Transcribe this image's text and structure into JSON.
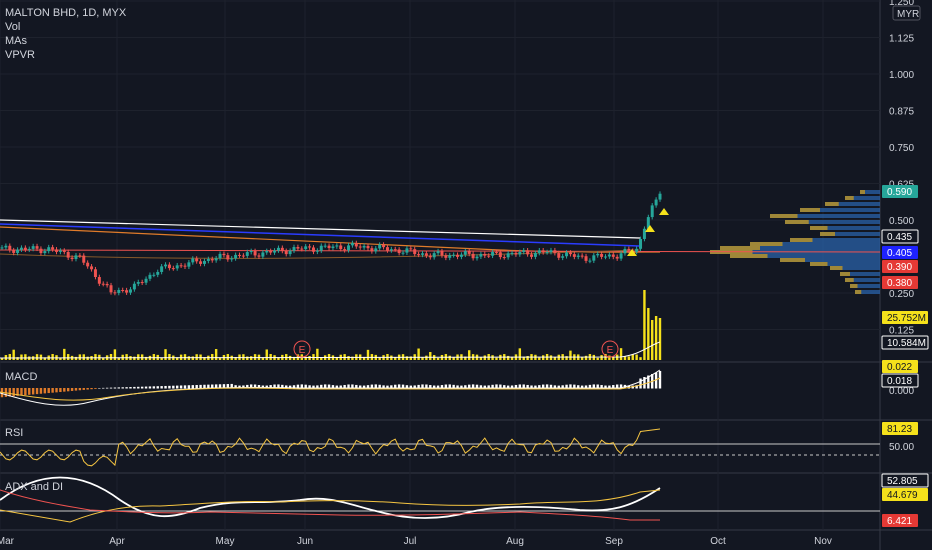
{
  "header": {
    "symbol_line": "MALTON BHD, 1D, MYX",
    "indicators": [
      "Vol",
      "MAs",
      "VPVR"
    ],
    "currency_button": "MYR"
  },
  "price_axis": {
    "ticks": [
      "1.250",
      "1.125",
      "1.000",
      "0.875",
      "0.750",
      "0.625",
      "0.500",
      "0.250",
      "0.125"
    ],
    "badges": [
      {
        "text": "0.590",
        "bg": "#26a69a",
        "fg": "#ffffff"
      },
      {
        "text": "0.435",
        "bg": "#131722",
        "fg": "#ffffff",
        "border": "#ffffff"
      },
      {
        "text": "0.405",
        "bg": "#1e22ff",
        "fg": "#ffffff"
      },
      {
        "text": "0.390",
        "bg": "#e53935",
        "fg": "#ffffff"
      },
      {
        "text": "0.380",
        "bg": "#e53935",
        "fg": "#ffffff"
      },
      {
        "text": "25.752M",
        "bg": "#f5e11b",
        "fg": "#131722"
      },
      {
        "text": "10.584M",
        "bg": "#131722",
        "fg": "#ffffff",
        "border": "#ffffff"
      }
    ]
  },
  "macd_panel": {
    "label": "MACD",
    "badges": [
      {
        "text": "0.022",
        "bg": "#f5e11b",
        "fg": "#131722"
      },
      {
        "text": "0.018",
        "bg": "#131722",
        "fg": "#ffffff",
        "border": "#ffffff"
      }
    ],
    "ticks": [
      "0.000"
    ]
  },
  "rsi_panel": {
    "label": "RSI",
    "badges": [
      {
        "text": "81.23",
        "bg": "#f5e11b",
        "fg": "#131722"
      }
    ],
    "ticks": [
      "50.00"
    ]
  },
  "adx_panel": {
    "label": "ADX and DI",
    "badges": [
      {
        "text": "52.805",
        "bg": "#131722",
        "fg": "#ffffff",
        "border": "#ffffff"
      },
      {
        "text": "44.679",
        "bg": "#f5e11b",
        "fg": "#131722"
      },
      {
        "text": "6.421",
        "bg": "#e53935",
        "fg": "#ffffff"
      }
    ]
  },
  "time_axis": [
    "Mar",
    "Apr",
    "May",
    "Jun",
    "Jul",
    "Aug",
    "Sep",
    "Oct",
    "Nov"
  ],
  "earnings_markers": [
    "E",
    "E"
  ],
  "colors": {
    "background": "#131722",
    "up": "#26a69a",
    "down": "#ef5350",
    "volume": "#f5e11b",
    "ma_white": "#ffffff",
    "ma_blue": "#2a3cff",
    "ma_orange": "#e07b2a",
    "ma_red": "#ef5350",
    "macd_signal": "#f5c542",
    "vpvr": "#2962a8",
    "vpvr_highlight": "#d4a017"
  },
  "chart_data": {
    "type": "line",
    "title": "MALTON BHD, 1D, MYX",
    "ylim": [
      0.18,
      1.25
    ],
    "price_approx": {
      "x": [
        "Mar",
        "Mar-mid",
        "Mar-late",
        "Apr",
        "Apr-mid",
        "May",
        "May-mid",
        "Jun",
        "Jun-mid",
        "Jul",
        "Jul-mid",
        "Aug",
        "Aug-mid",
        "Sep",
        "Sep-early",
        "Sep-mid"
      ],
      "close": [
        0.4,
        0.37,
        0.24,
        0.34,
        0.38,
        0.4,
        0.41,
        0.4,
        0.38,
        0.38,
        0.39,
        0.38,
        0.38,
        0.4,
        0.52,
        0.59
      ]
    },
    "volume_last": 25752000,
    "volume_ma": 10584000,
    "rsi_last": 81.23,
    "adx_last": 52.805,
    "di_plus_last": 44.679,
    "di_minus_last": 6.421,
    "macd_last": 0.022,
    "macd_signal_last": 0.018
  }
}
